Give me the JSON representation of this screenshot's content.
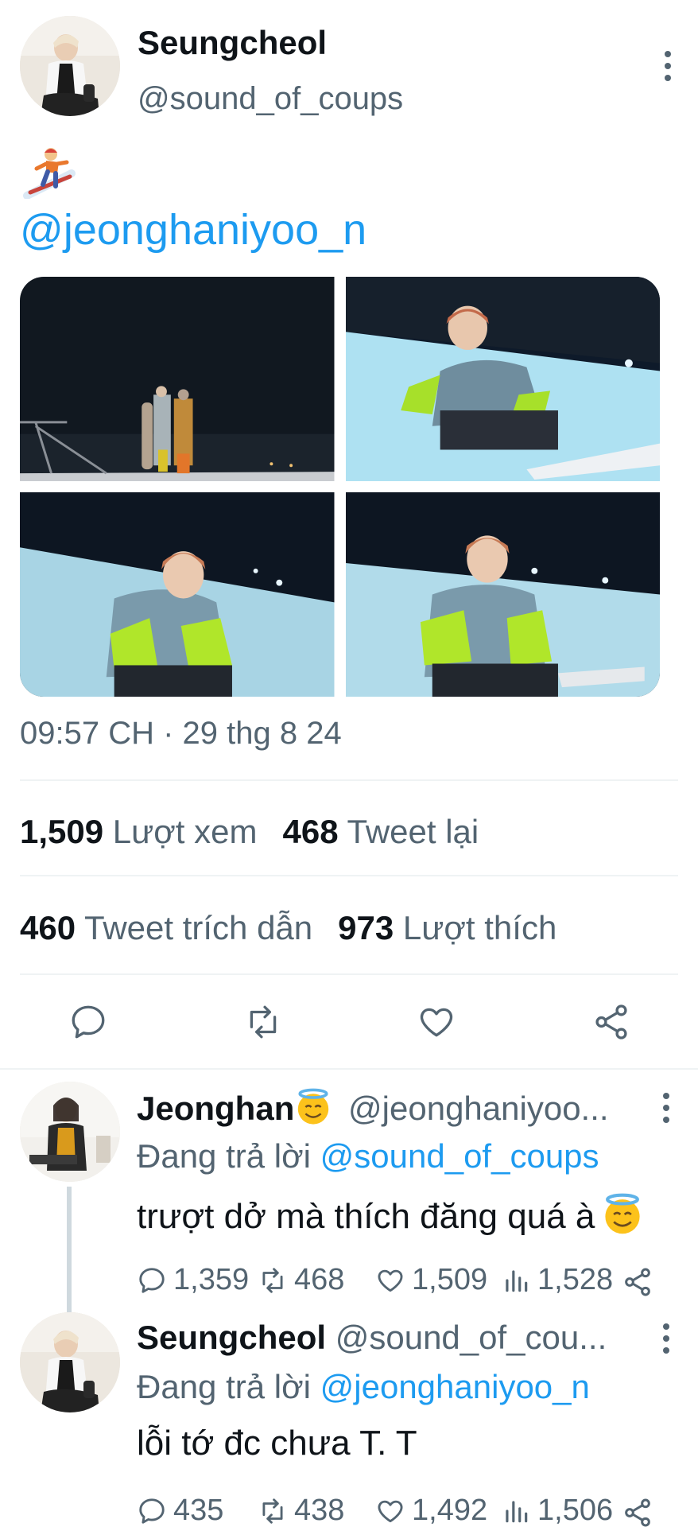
{
  "tweet": {
    "author_name": "Seungcheol",
    "author_handle": "@sound_of_coups",
    "emoji": "snowboarder-emoji",
    "mention": "@jeonghaniyoo_n",
    "timestamp": "09:57 CH · 29 thg 8 24",
    "stats": {
      "views_count": "1,509",
      "views_label": "Lượt xem",
      "retweets_count": "468",
      "retweets_label": "Tweet lại",
      "quotes_count": "460",
      "quotes_label": "Tweet trích dẫn",
      "likes_count": "973",
      "likes_label": "Lượt thích"
    },
    "actions": [
      "reply-icon",
      "retweet-icon",
      "like-icon",
      "share-icon"
    ]
  },
  "replies": [
    {
      "name": "Jeonghan",
      "badge": "halo-emoji",
      "handle": "@jeonghaniyoo...",
      "replying_prefix": "Đang trả lời",
      "replying_to": "@sound_of_coups",
      "text": "trượt dở mà thích đăng quá à",
      "text_emoji": "halo-emoji",
      "replies": "1,359",
      "retweets": "468",
      "likes": "1,509",
      "views": "1,528"
    },
    {
      "name": "Seungcheol",
      "handle": "@sound_of_cou...",
      "replying_prefix": "Đang trả lời",
      "replying_to": "@jeonghaniyoo_n",
      "text": "lỗi tớ đc chưa T. T",
      "replies": "435",
      "retweets": "438",
      "likes": "1,492",
      "views": "1,506"
    }
  ],
  "colors": {
    "link": "#1d9bf0",
    "secondary_text": "#536471",
    "primary_text": "#0f1419",
    "divider": "#eff3f4"
  }
}
